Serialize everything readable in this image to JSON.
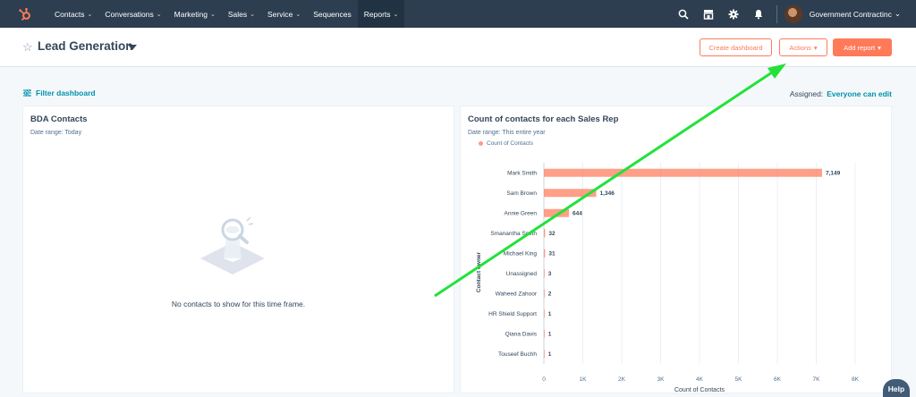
{
  "nav": {
    "items": [
      {
        "label": "Contacts",
        "chevron": true
      },
      {
        "label": "Conversations",
        "chevron": true
      },
      {
        "label": "Marketing",
        "chevron": true
      },
      {
        "label": "Sales",
        "chevron": true
      },
      {
        "label": "Service",
        "chevron": true
      },
      {
        "label": "Sequences",
        "chevron": false
      },
      {
        "label": "Reports",
        "chevron": true,
        "active": true
      }
    ],
    "account_name": "Government Contractinc",
    "icons": [
      "search-icon",
      "marketplace-icon",
      "settings-icon",
      "notifications-icon"
    ]
  },
  "header": {
    "title": "Lead Generation",
    "create_dashboard": "Create dashboard",
    "actions": "Actions",
    "add_report": "Add report"
  },
  "filter": {
    "label": "Filter dashboard",
    "assigned_label": "Assigned:",
    "assigned_value": "Everyone can edit"
  },
  "cards": {
    "bda": {
      "title": "BDA Contacts",
      "date_range": "Date range: Today",
      "empty_message": "No contacts to show for this time frame."
    },
    "sales_rep": {
      "title": "Count of contacts for each Sales Rep",
      "date_range": "Date range: This entire year"
    }
  },
  "chart_data": {
    "type": "bar",
    "orientation": "horizontal",
    "categories": [
      "Mark Smith",
      "Sam Brown",
      "Annie Green",
      "Smanantha Smith",
      "Michael King",
      "Unassigned",
      "Waheed Zahoor",
      "HR Shield Support",
      "Qiana Davis",
      "Touseef Buchh"
    ],
    "series": [
      {
        "name": "Count of Contacts",
        "values": [
          7149,
          1346,
          644,
          32,
          31,
          3,
          2,
          1,
          1,
          1
        ]
      }
    ],
    "value_labels": [
      "7,149",
      "1,346",
      "644",
      "32",
      "31",
      "3",
      "2",
      "1",
      "1",
      "1"
    ],
    "xlabel": "Count of Contacts",
    "ylabel": "Contact owner",
    "xlim": [
      0,
      8000
    ],
    "xticks": [
      "0",
      "1K",
      "2K",
      "3K",
      "4K",
      "5K",
      "6K",
      "7K",
      "8K"
    ],
    "grid": true,
    "legend": "top-left",
    "color": "#ff7a59"
  },
  "help": {
    "label": "Help"
  },
  "colors": {
    "nav_bg": "#2d3e50",
    "accent": "#ff7a59",
    "link": "#0091ae",
    "annotation_arrow": "#22e23a"
  }
}
